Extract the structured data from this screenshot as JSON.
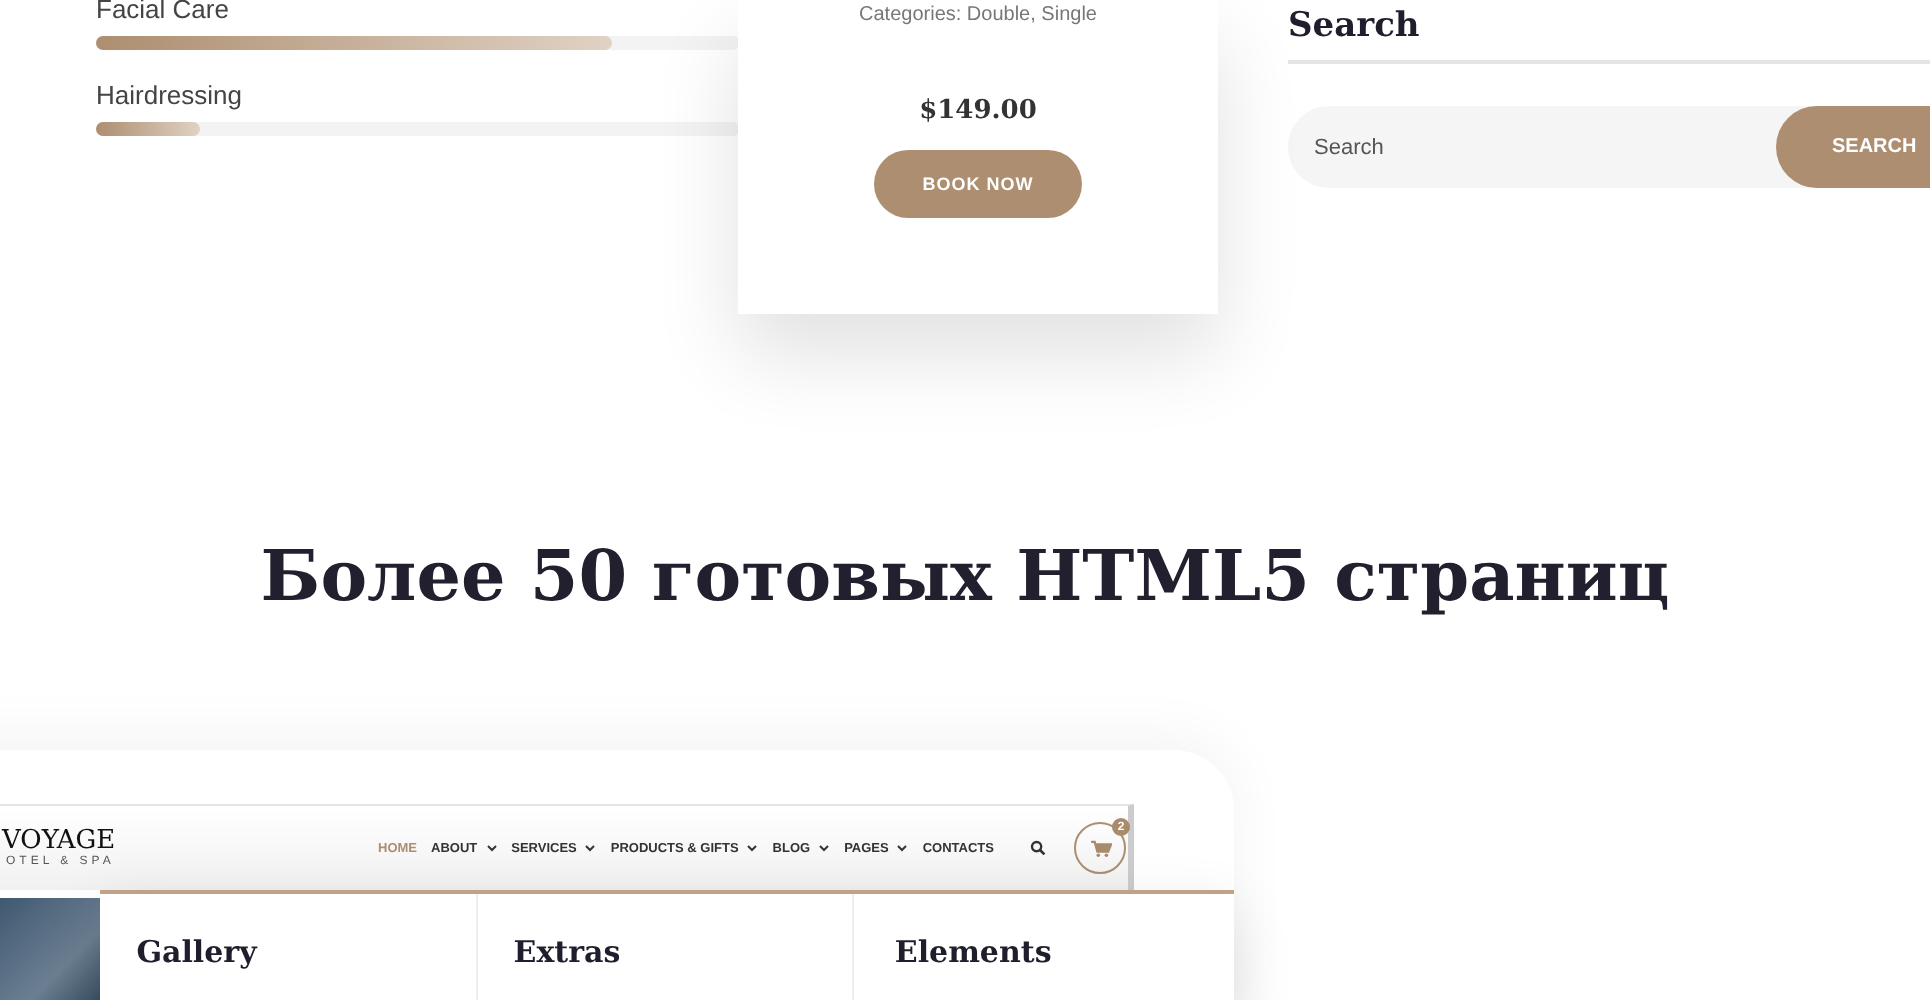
{
  "skills": [
    {
      "label": "Facial Care",
      "level": 0.8
    },
    {
      "label": "Hairdressing",
      "level": 0.16
    }
  ],
  "room_card": {
    "categories": "Categories: Double, Single",
    "price": "$149.00",
    "button": "BOOK NOW"
  },
  "search_widget": {
    "title": "Search",
    "placeholder": "Search",
    "button": "SEARCH"
  },
  "headline": "Более 50 готовых HTML5 страниц",
  "preview": {
    "logo": "VOYAGE",
    "tagline": "OTEL & SPA",
    "nav": [
      {
        "label": "HOME",
        "selected": true,
        "dropdown": false
      },
      {
        "label": "ABOUT",
        "selected": false,
        "dropdown": true
      },
      {
        "label": "SERVICES",
        "selected": false,
        "dropdown": true
      },
      {
        "label": "PRODUCTS & GIFTS",
        "selected": false,
        "dropdown": true
      },
      {
        "label": "BLOG",
        "selected": false,
        "dropdown": true
      },
      {
        "label": "PAGES",
        "selected": false,
        "dropdown": true
      },
      {
        "label": "CONTACTS",
        "selected": false,
        "dropdown": false
      }
    ],
    "cart_count": "2",
    "menu_columns": [
      "Gallery",
      "Extras",
      "Elements"
    ]
  }
}
